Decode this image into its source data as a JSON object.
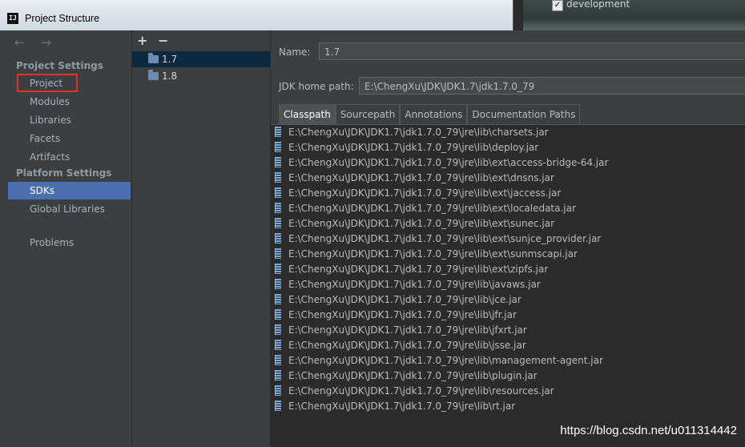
{
  "window": {
    "title": "Project Structure",
    "logo": "IJ"
  },
  "background_window": {
    "checkbox_label": "development",
    "checked": true
  },
  "nav": {
    "arrows": "← →",
    "sections": [
      {
        "label": "Project Settings",
        "items": [
          "Project",
          "Modules",
          "Libraries",
          "Facets",
          "Artifacts"
        ]
      },
      {
        "label": "Platform Settings",
        "items": [
          "SDKs",
          "Global Libraries"
        ]
      }
    ],
    "problems": "Problems",
    "selected": "SDKs",
    "highlighted": "Project"
  },
  "sdk_list": {
    "add": "+",
    "remove": "−",
    "items": [
      "1.7",
      "1.8"
    ],
    "selected": "1.7"
  },
  "detail": {
    "name_label": "Name:",
    "name_value": "1.7",
    "jdk_label": "JDK home path:",
    "jdk_value": "E:\\ChengXu\\JDK\\JDK1.7\\jdk1.7.0_79",
    "tabs": [
      "Classpath",
      "Sourcepath",
      "Annotations",
      "Documentation Paths"
    ],
    "active_tab": "Classpath",
    "classpath": [
      "E:\\ChengXu\\JDK\\JDK1.7\\jdk1.7.0_79\\jre\\lib\\charsets.jar",
      "E:\\ChengXu\\JDK\\JDK1.7\\jdk1.7.0_79\\jre\\lib\\deploy.jar",
      "E:\\ChengXu\\JDK\\JDK1.7\\jdk1.7.0_79\\jre\\lib\\ext\\access-bridge-64.jar",
      "E:\\ChengXu\\JDK\\JDK1.7\\jdk1.7.0_79\\jre\\lib\\ext\\dnsns.jar",
      "E:\\ChengXu\\JDK\\JDK1.7\\jdk1.7.0_79\\jre\\lib\\ext\\jaccess.jar",
      "E:\\ChengXu\\JDK\\JDK1.7\\jdk1.7.0_79\\jre\\lib\\ext\\localedata.jar",
      "E:\\ChengXu\\JDK\\JDK1.7\\jdk1.7.0_79\\jre\\lib\\ext\\sunec.jar",
      "E:\\ChengXu\\JDK\\JDK1.7\\jdk1.7.0_79\\jre\\lib\\ext\\sunjce_provider.jar",
      "E:\\ChengXu\\JDK\\JDK1.7\\jdk1.7.0_79\\jre\\lib\\ext\\sunmscapi.jar",
      "E:\\ChengXu\\JDK\\JDK1.7\\jdk1.7.0_79\\jre\\lib\\ext\\zipfs.jar",
      "E:\\ChengXu\\JDK\\JDK1.7\\jdk1.7.0_79\\jre\\lib\\javaws.jar",
      "E:\\ChengXu\\JDK\\JDK1.7\\jdk1.7.0_79\\jre\\lib\\jce.jar",
      "E:\\ChengXu\\JDK\\JDK1.7\\jdk1.7.0_79\\jre\\lib\\jfr.jar",
      "E:\\ChengXu\\JDK\\JDK1.7\\jdk1.7.0_79\\jre\\lib\\jfxrt.jar",
      "E:\\ChengXu\\JDK\\JDK1.7\\jdk1.7.0_79\\jre\\lib\\jsse.jar",
      "E:\\ChengXu\\JDK\\JDK1.7\\jdk1.7.0_79\\jre\\lib\\management-agent.jar",
      "E:\\ChengXu\\JDK\\JDK1.7\\jdk1.7.0_79\\jre\\lib\\plugin.jar",
      "E:\\ChengXu\\JDK\\JDK1.7\\jdk1.7.0_79\\jre\\lib\\resources.jar",
      "E:\\ChengXu\\JDK\\JDK1.7\\jdk1.7.0_79\\jre\\lib\\rt.jar"
    ]
  },
  "watermark": "https://blog.csdn.net/u011314442",
  "colors": {
    "selection": "#4b6eaf",
    "highlight_box": "#e2312b",
    "background": "#3c3f41"
  }
}
